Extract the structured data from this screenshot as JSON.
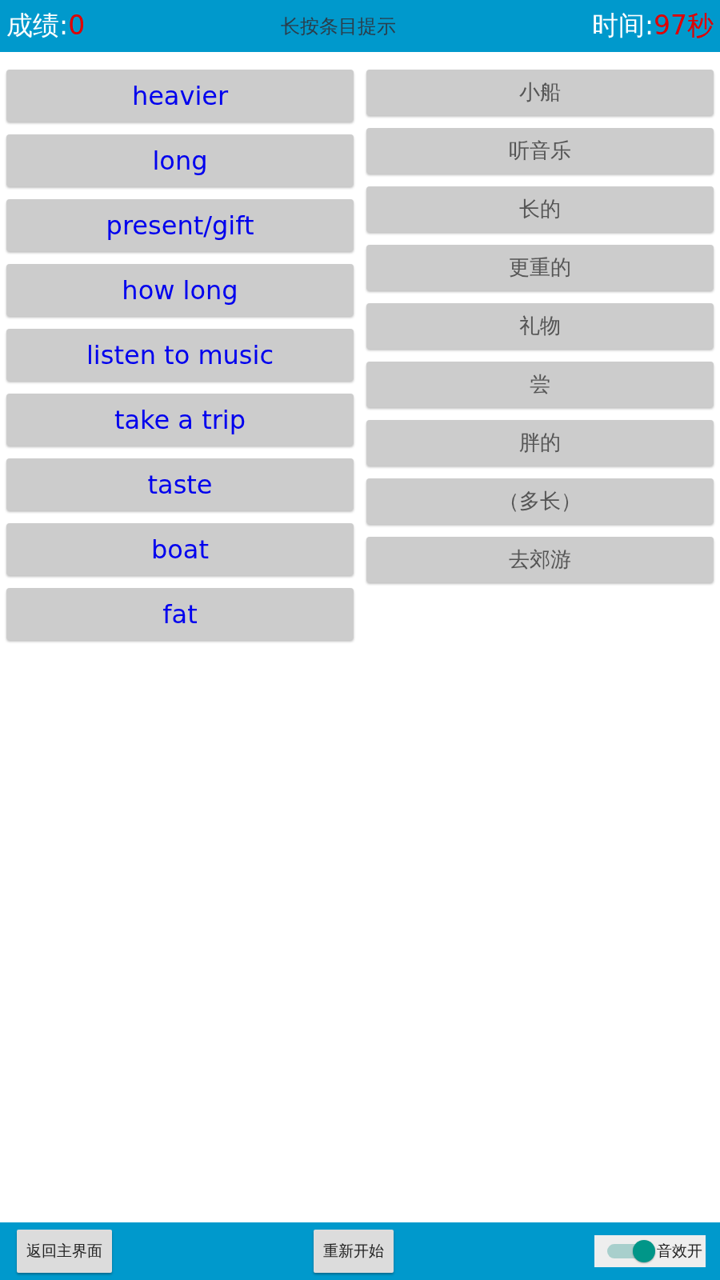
{
  "header": {
    "score_label": "成绩:",
    "score": "0",
    "hint": "长按条目提示",
    "time_label": "时间:",
    "time": "97秒"
  },
  "english_items": [
    {
      "text": "heavier"
    },
    {
      "text": "long"
    },
    {
      "text": "present/gift"
    },
    {
      "text": "how long"
    },
    {
      "text": "listen to music"
    },
    {
      "text": "take a trip"
    },
    {
      "text": "taste"
    },
    {
      "text": "boat"
    },
    {
      "text": "fat"
    }
  ],
  "chinese_items": [
    {
      "text": "小船"
    },
    {
      "text": "听音乐"
    },
    {
      "text": "长的"
    },
    {
      "text": "更重的"
    },
    {
      "text": "礼物"
    },
    {
      "text": "尝"
    },
    {
      "text": "胖的"
    },
    {
      "text": "（多长）"
    },
    {
      "text": "去郊游"
    }
  ],
  "footer": {
    "back_button": "返回主界面",
    "restart_button": "重新开始",
    "sound_toggle": {
      "label": "音效开",
      "on": true
    }
  }
}
